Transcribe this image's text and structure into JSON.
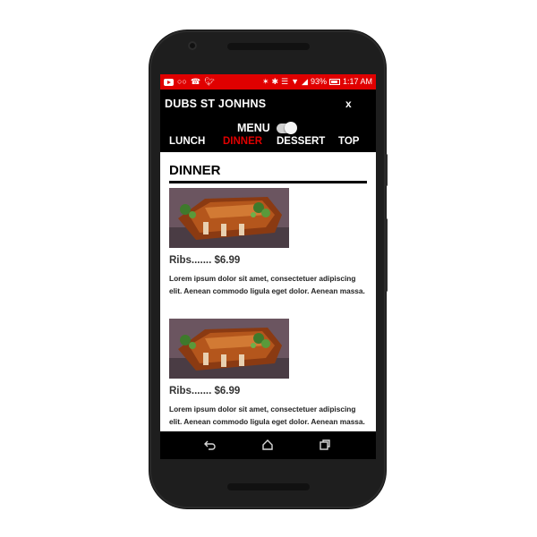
{
  "status_bar": {
    "battery": "93%",
    "time": "1:17 AM"
  },
  "header": {
    "title": "DUBS ST JONHNS",
    "close_label": "x",
    "menu_label": "MENU",
    "menu_toggle_on": true
  },
  "tabs": [
    {
      "label": "LUNCH",
      "active": false
    },
    {
      "label": "DINNER",
      "active": true
    },
    {
      "label": "DESSERT",
      "active": false
    },
    {
      "label": "TOP",
      "active": false
    }
  ],
  "section": {
    "title": "DINNER"
  },
  "items": [
    {
      "name_price": "Ribs....... $6.99",
      "description": "Lorem ipsum dolor sit amet, consectetuer adipiscing elit. Aenean commodo ligula eget dolor. Aenean massa."
    },
    {
      "name_price": "Ribs....... $6.99",
      "description": "Lorem ipsum dolor sit amet, consectetuer adipiscing elit. Aenean commodo ligula eget dolor. Aenean massa."
    }
  ],
  "icons": {
    "back": "back-icon",
    "home": "home-icon",
    "recents": "recents-icon"
  },
  "colors": {
    "accent": "#e00000",
    "header_bg": "#000000"
  }
}
